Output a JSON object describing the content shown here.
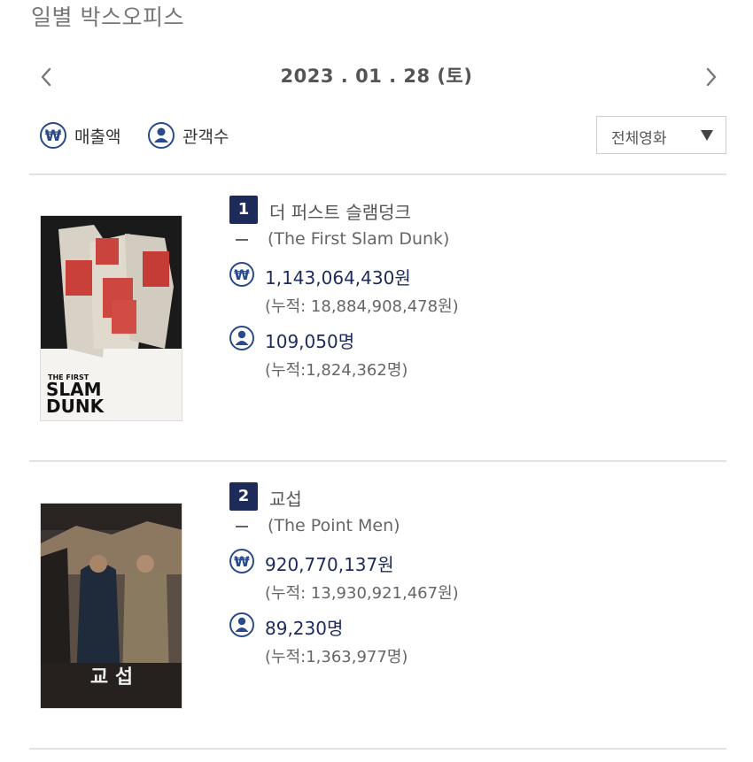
{
  "page": {
    "title": "일별 박스오피스"
  },
  "date_nav": {
    "date": "2023 . 01 . 28  (토)",
    "prev_label": "‹",
    "next_label": "›"
  },
  "toggles": {
    "sales_label": "매출액",
    "audience_label": "관객수",
    "sales_icon": "won-icon",
    "audience_icon": "person-icon"
  },
  "filter": {
    "selected": "전체영화"
  },
  "colors": {
    "accent": "#1d2b5a",
    "divider": "#e2e2e2"
  },
  "movies": [
    {
      "rank": "1",
      "title_kr": "더 퍼스트 슬램덩크",
      "title_en": "(The First Slam Dunk)",
      "sales": "1,143,064,430원",
      "sales_total": "(누적: 18,884,908,478원)",
      "audience": "109,050명",
      "audience_total": "(누적:1,824,362명)",
      "poster": {
        "text_line1": "THE FIRST",
        "text_line2": "SLAM",
        "text_line3": "DUNK"
      }
    },
    {
      "rank": "2",
      "title_kr": "교섭",
      "title_en": "(The Point Men)",
      "sales": "920,770,137원",
      "sales_total": "(누적: 13,930,921,467원)",
      "audience": "89,230명",
      "audience_total": "(누적:1,363,977명)",
      "poster": {
        "text_line1": "교 섭"
      }
    }
  ]
}
